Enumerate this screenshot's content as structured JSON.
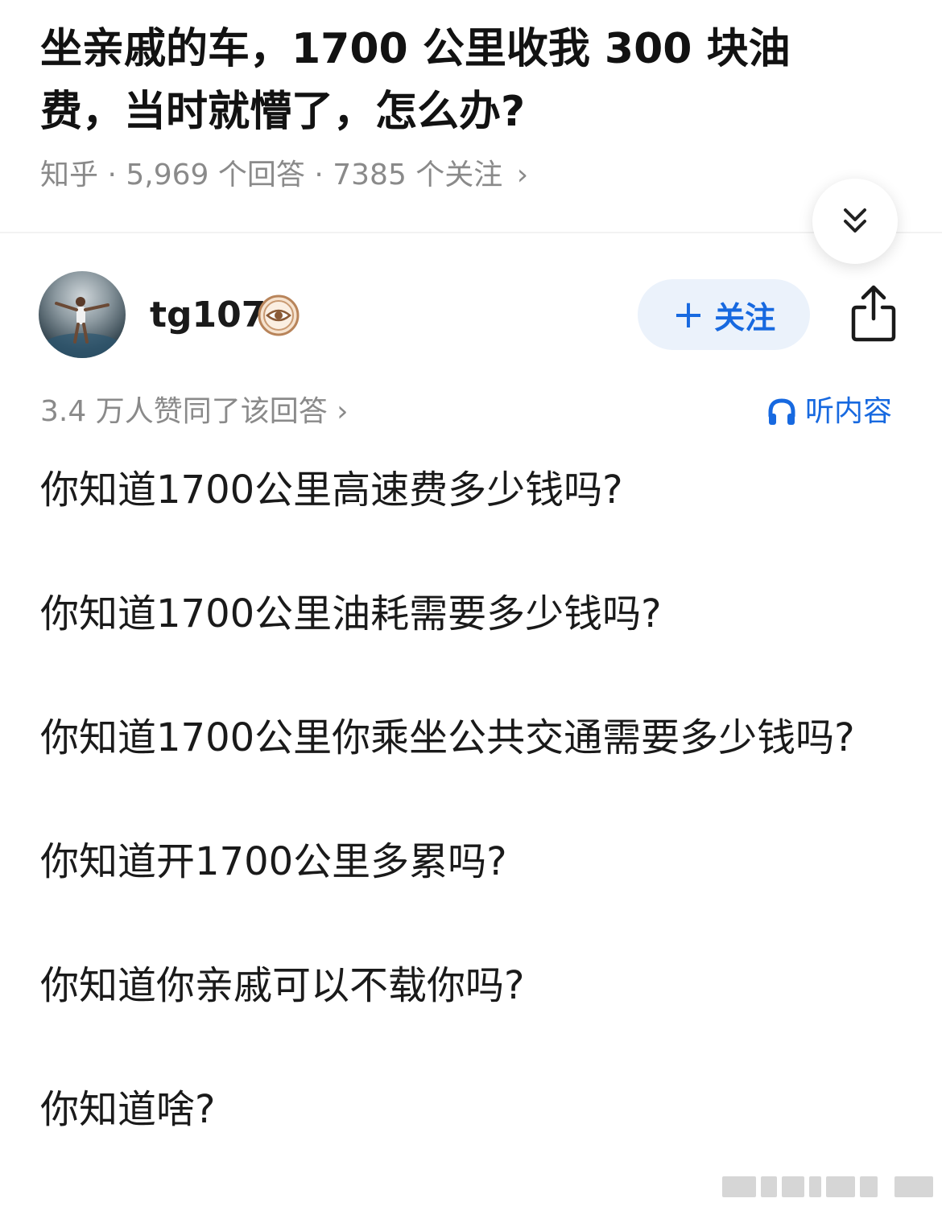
{
  "question": {
    "title": "坐亲戚的车，1700 公里收我 300 块油费，当时就懵了，怎么办?",
    "source": "知乎",
    "answer_count": "5,969 个回答",
    "follower_count": "7385 个关注",
    "separator": "·",
    "chevron": "›"
  },
  "author": {
    "name": "tg107",
    "follow_label": "关注",
    "follow_plus": "+"
  },
  "answer": {
    "likes": "3.4 万人赞同了该回答",
    "chevron": "›",
    "listen_label": "听内容",
    "paragraphs": [
      "你知道1700公里高速费多少钱吗?",
      "你知道1700公里油耗需要多少钱吗?",
      "你知道1700公里你乘坐公共交通需要多少钱吗?",
      "你知道开1700公里多累吗?",
      "你知道你亲戚可以不载你吗?",
      "你知道啥?"
    ]
  },
  "icons": {
    "collapse": "double-chevron-down-icon",
    "share": "share-icon",
    "listen": "headphones-icon",
    "badge": "eye-badge-icon"
  },
  "colors": {
    "accent": "#1769e0",
    "follow_bg": "#ebf2fb",
    "meta_text": "#8a8a8a",
    "body_text": "#1a1a1a"
  }
}
